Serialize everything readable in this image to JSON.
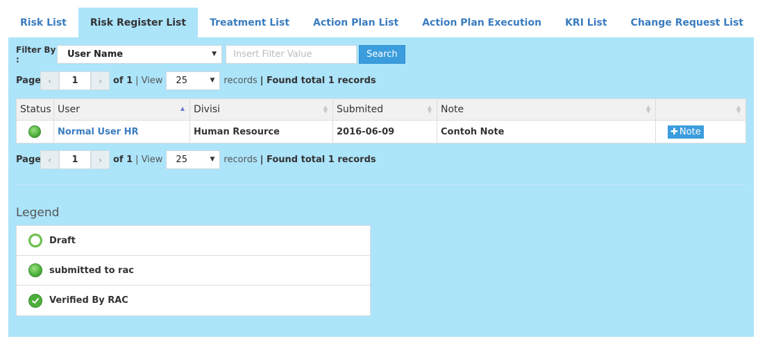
{
  "tabs": [
    {
      "label": "Risk List",
      "active": false
    },
    {
      "label": "Risk Register List",
      "active": true
    },
    {
      "label": "Treatment List",
      "active": false
    },
    {
      "label": "Action Plan List",
      "active": false
    },
    {
      "label": "Action Plan Execution",
      "active": false
    },
    {
      "label": "KRI List",
      "active": false
    },
    {
      "label": "Change Request List",
      "active": false
    }
  ],
  "filter": {
    "label": "Filter By :",
    "selected": "User Name",
    "placeholder": "Insert Filter Value",
    "search_label": "Search"
  },
  "pager": {
    "page_label": "Page",
    "prev": "‹",
    "next": "›",
    "page_value": "1",
    "of_text": "of 1",
    "separator": "|",
    "view_label": "View",
    "view_value": "25",
    "records_label": "records",
    "found_text": "| Found total 1 records"
  },
  "table": {
    "columns": [
      "Status",
      "User",
      "Divisi",
      "Submited",
      "Note",
      ""
    ],
    "rows": [
      {
        "status": "submitted to rac",
        "user": "Normal User HR",
        "divisi": "Human Resource",
        "submited": "2016-06-09",
        "note": "Contoh Note",
        "action": "Note"
      }
    ]
  },
  "legend": {
    "title": "Legend",
    "items": [
      {
        "label": "Draft",
        "icon": "draft-icon"
      },
      {
        "label": "submitted to rac",
        "icon": "submitted-icon"
      },
      {
        "label": "Verified By RAC",
        "icon": "verified-icon"
      }
    ]
  },
  "colors": {
    "panel": "#ace4fa",
    "link": "#3a7cbf",
    "button": "#3b9ddd",
    "status_green": "#4caf3a"
  }
}
